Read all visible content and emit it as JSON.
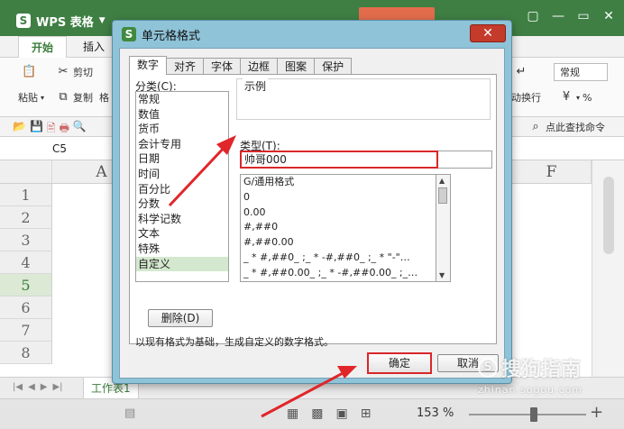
{
  "app": {
    "title": "WPS 表格",
    "ribbon_tabs": [
      "开始",
      "插入"
    ],
    "ribbon": {
      "cut": "剪切",
      "paste": "粘贴",
      "copy": "复制",
      "format_painter": "格",
      "wrap_text": "自动换行",
      "number_format": "常规",
      "percent": "%"
    },
    "search": "点此查找命令",
    "name_box": "C5",
    "columns": [
      "A",
      "F"
    ],
    "rows": [
      "1",
      "2",
      "3",
      "4",
      "5",
      "6",
      "7",
      "8"
    ],
    "selected_row": "5",
    "sheet_tab": "工作表1",
    "zoom": "153 %",
    "zoom_plus": "+",
    "zoom_fraction": 0.55
  },
  "dialog": {
    "title": "单元格格式",
    "close": "✕",
    "tabs": [
      "数字",
      "对齐",
      "字体",
      "边框",
      "图案",
      "保护"
    ],
    "active_tab": "数字",
    "category_label": "分类(C):",
    "categories": [
      "常规",
      "数值",
      "货币",
      "会计专用",
      "日期",
      "时间",
      "百分比",
      "分数",
      "科学记数",
      "文本",
      "特殊",
      "自定义"
    ],
    "selected_category": "自定义",
    "example_label": "示例",
    "type_label": "类型(T):",
    "type_value": "帅哥000",
    "format_list": [
      "G/通用格式",
      "0",
      "0.00",
      "#,##0",
      "#,##0.00",
      "_ * #,##0_ ;_ * -#,##0_ ;_ * \"-\"…",
      "_ * #,##0.00_ ;_ * -#,##0.00_ ;_…"
    ],
    "delete_button": "删除(D)",
    "description": "以现有格式为基础，生成自定义的数字格式。",
    "ok": "确定",
    "cancel": "取消"
  },
  "watermark": {
    "name": "搜狗指南",
    "url": "zhinan.sogou.com"
  },
  "colors": {
    "title_green": "#3f7f44",
    "highlight_red": "#d8272a",
    "dialog_frame": "#8ec3d8",
    "selected_category": "#d4e8cf"
  }
}
